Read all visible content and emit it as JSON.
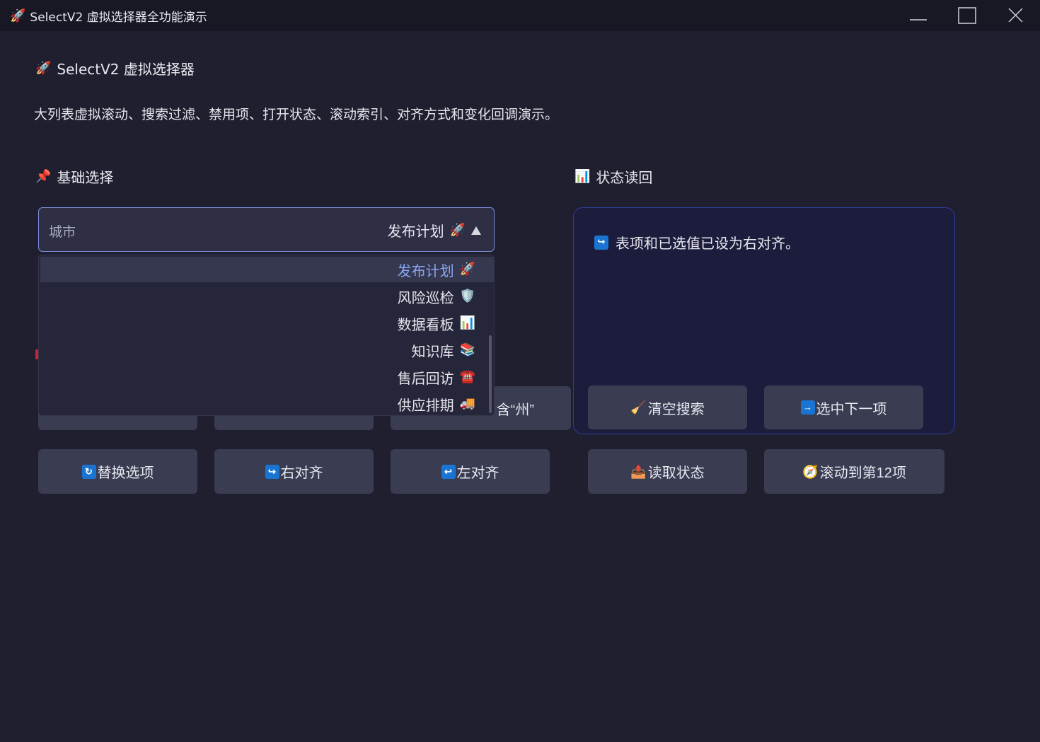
{
  "window": {
    "title": "SelectV2 虚拟选择器全功能演示"
  },
  "header": {
    "title": "SelectV2 虚拟选择器",
    "subtitle": "大列表虚拟滚动、搜索过滤、禁用项、打开状态、滚动索引、对齐方式和变化回调演示。"
  },
  "sections": {
    "basic": {
      "title": "基础选择"
    },
    "state": {
      "title": "状态读回"
    }
  },
  "select": {
    "label": "城市",
    "selected": "发布计划",
    "selected_icon": "🚀"
  },
  "dropdown": {
    "items": [
      {
        "label": "发布计划",
        "icon": "🚀"
      },
      {
        "label": "风险巡检",
        "icon": "🛡️"
      },
      {
        "label": "数据看板",
        "icon": "📊"
      },
      {
        "label": "知识库",
        "icon": "📚"
      },
      {
        "label": "售后回访",
        "icon": "☎️"
      },
      {
        "label": "供应排期",
        "icon": "🚚"
      }
    ]
  },
  "state_panel": {
    "message": "表项和已选值已设为右对齐。"
  },
  "buttons": {
    "partial_label": "含“州”",
    "clear_search": "清空搜索",
    "select_next": "选中下一项",
    "replace_options": "替换选项",
    "align_right": "右对齐",
    "align_left": "左对齐",
    "read_state": "读取状态",
    "scroll_to_12": "滚动到第12项"
  },
  "icons": {
    "app": "rocket-icon",
    "pin": "pushpin-icon",
    "chart": "bar-chart-icon",
    "broom": "broom-icon",
    "arrow_right": "right-arrow-icon",
    "refresh": "refresh-icon",
    "return_right": "return-right-icon",
    "return_left": "return-left-icon",
    "outbox": "outbox-tray-icon",
    "compass": "compass-icon"
  },
  "colors": {
    "accent": "#89a6f2",
    "panel_border": "#2c3c9a"
  }
}
